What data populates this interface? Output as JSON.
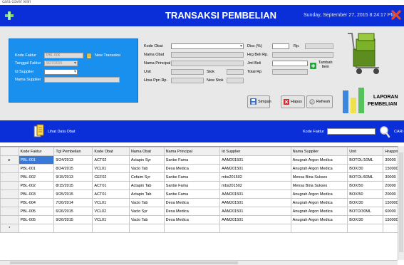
{
  "window": {
    "caption": "cara cover lelin",
    "title": "TRANSAKSI PEMBELIAN",
    "date_time": "Sunday, September 27, 2015   8:24:17 PM"
  },
  "colors": {
    "title_bar": "#0a2fd9",
    "panel_blue": "#1a90ee",
    "selected_row": "#3778d8"
  },
  "left_panel": {
    "kode_faktur_label": "Kode Faktur",
    "kode_faktur_value": "PBL-006",
    "new_transaksi_label": "New Transaksi",
    "tanggal_faktur_label": "Tanggal Faktur",
    "tanggal_faktur_value": "9/27/2015",
    "id_supplier_label": "Id Supplier",
    "id_supplier_value": "",
    "nama_supplier_label": "Nama Supplier",
    "nama_supplier_value": ""
  },
  "obat_panel": {
    "kode_obat_label": "Kode Obat",
    "nama_obat_label": "Nama Obat",
    "nama_principal_label": "Nama Principal",
    "unit_label": "Unit",
    "stok_label": "Stok",
    "hrsa_ppn_label": "Hrsa Ppn Rp.",
    "new_stok_label": "New Stok"
  },
  "pay_panel": {
    "disc_label": "Disc (%)",
    "rp_label": "Rp.",
    "hrg_beli_label": "Hrg Beli Rp.",
    "jml_beli_label": "Jml Beli",
    "total_label": "Total Rp",
    "tambah_item_label": "Tambah\nItem"
  },
  "actions": {
    "simpan": "Simpan",
    "hapus": "Hapus",
    "refresh": "Refresh"
  },
  "laporan": {
    "line1": "LAPORAN",
    "line2": "PEMBELIAN"
  },
  "nav": {
    "lihat_data_obat": "Lihat Data Obat",
    "kode_faktur_label": "Kode Faktur",
    "cari_label": "CARI"
  },
  "table": {
    "columns": [
      "Kode Faktur",
      "Tgl Pembelian",
      "Kode Obat",
      "Nama Obat",
      "Nama Principal",
      "Id Supplier",
      "Nama Supplier",
      "Unit",
      "Hrappn"
    ],
    "rows": [
      [
        "PBL-001",
        "9/24/2013",
        "ACT02",
        "Actapin Syr",
        "Sanbe Fama",
        "AAM201501",
        "Anugrah Argon Medica",
        "BOTOL/10ML",
        "30000"
      ],
      [
        "PBL-001",
        "8/24/2015",
        "VCL01",
        "Vaclo Tab",
        "Dexa Medica",
        "AAM201501",
        "Anugrah Argon Medica",
        "BOX/30",
        "150000"
      ],
      [
        "PBL-002",
        "9/15/2013",
        "CEF02",
        "Cefaim Syr",
        "Sanbe Fama",
        "mbs201502",
        "Mensa Bina Sukses",
        "BOTOL/60ML",
        "30000"
      ],
      [
        "PBL-002",
        "8/15/2015",
        "ACT01",
        "Actapin Tab",
        "Sanbe Fama",
        "mbs201502",
        "Mensa Bina Sukses",
        "BOX/50",
        "20000"
      ],
      [
        "PBL-003",
        "9/25/2015",
        "ACT01",
        "Actapin Tab",
        "Sanbe Fama",
        "AAM201501",
        "Anugrah Argon Medica",
        "BOX/50",
        "20000"
      ],
      [
        "PBL-004",
        "7/26/2014",
        "VCL01",
        "Vaclo Tab",
        "Dexa Medica",
        "AAM201501",
        "Anugrah Argon Medica",
        "BOX/30",
        "150000"
      ],
      [
        "PBL-005",
        "6/26/2015",
        "VCL02",
        "Vaclo Syr",
        "Dexa Medica",
        "AAM201501",
        "Anugrah Argon Medica",
        "BOTO/30ML",
        "60000"
      ],
      [
        "PBL-005",
        "9/26/2015",
        "VCL01",
        "Vaclo Tab",
        "Dexa Medica",
        "AAM201501",
        "Anugrah Argon Medica",
        "BOX/30",
        "150000"
      ]
    ],
    "new_row_marker": "*",
    "current_row_marker": "▸"
  }
}
